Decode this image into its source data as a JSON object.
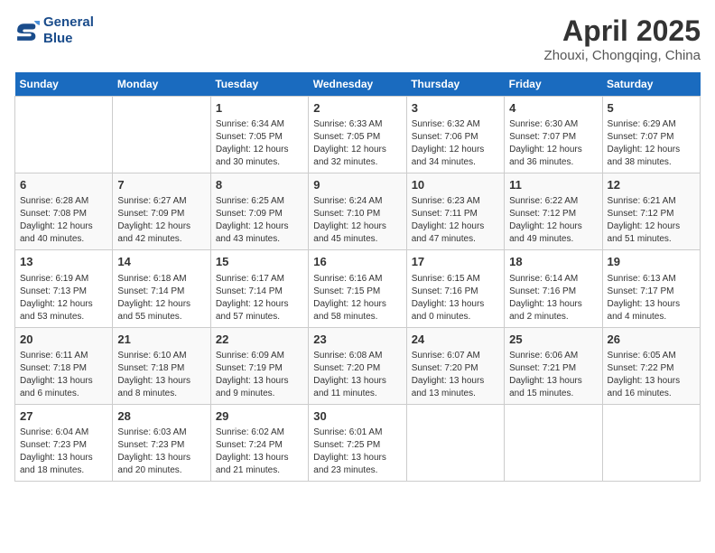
{
  "header": {
    "logo_line1": "General",
    "logo_line2": "Blue",
    "month": "April 2025",
    "location": "Zhouxi, Chongqing, China"
  },
  "weekdays": [
    "Sunday",
    "Monday",
    "Tuesday",
    "Wednesday",
    "Thursday",
    "Friday",
    "Saturday"
  ],
  "weeks": [
    [
      {
        "day": null
      },
      {
        "day": null
      },
      {
        "day": 1,
        "sunrise": "6:34 AM",
        "sunset": "7:05 PM",
        "daylight": "12 hours and 30 minutes."
      },
      {
        "day": 2,
        "sunrise": "6:33 AM",
        "sunset": "7:05 PM",
        "daylight": "12 hours and 32 minutes."
      },
      {
        "day": 3,
        "sunrise": "6:32 AM",
        "sunset": "7:06 PM",
        "daylight": "12 hours and 34 minutes."
      },
      {
        "day": 4,
        "sunrise": "6:30 AM",
        "sunset": "7:07 PM",
        "daylight": "12 hours and 36 minutes."
      },
      {
        "day": 5,
        "sunrise": "6:29 AM",
        "sunset": "7:07 PM",
        "daylight": "12 hours and 38 minutes."
      }
    ],
    [
      {
        "day": 6,
        "sunrise": "6:28 AM",
        "sunset": "7:08 PM",
        "daylight": "12 hours and 40 minutes."
      },
      {
        "day": 7,
        "sunrise": "6:27 AM",
        "sunset": "7:09 PM",
        "daylight": "12 hours and 42 minutes."
      },
      {
        "day": 8,
        "sunrise": "6:25 AM",
        "sunset": "7:09 PM",
        "daylight": "12 hours and 43 minutes."
      },
      {
        "day": 9,
        "sunrise": "6:24 AM",
        "sunset": "7:10 PM",
        "daylight": "12 hours and 45 minutes."
      },
      {
        "day": 10,
        "sunrise": "6:23 AM",
        "sunset": "7:11 PM",
        "daylight": "12 hours and 47 minutes."
      },
      {
        "day": 11,
        "sunrise": "6:22 AM",
        "sunset": "7:12 PM",
        "daylight": "12 hours and 49 minutes."
      },
      {
        "day": 12,
        "sunrise": "6:21 AM",
        "sunset": "7:12 PM",
        "daylight": "12 hours and 51 minutes."
      }
    ],
    [
      {
        "day": 13,
        "sunrise": "6:19 AM",
        "sunset": "7:13 PM",
        "daylight": "12 hours and 53 minutes."
      },
      {
        "day": 14,
        "sunrise": "6:18 AM",
        "sunset": "7:14 PM",
        "daylight": "12 hours and 55 minutes."
      },
      {
        "day": 15,
        "sunrise": "6:17 AM",
        "sunset": "7:14 PM",
        "daylight": "12 hours and 57 minutes."
      },
      {
        "day": 16,
        "sunrise": "6:16 AM",
        "sunset": "7:15 PM",
        "daylight": "12 hours and 58 minutes."
      },
      {
        "day": 17,
        "sunrise": "6:15 AM",
        "sunset": "7:16 PM",
        "daylight": "13 hours and 0 minutes."
      },
      {
        "day": 18,
        "sunrise": "6:14 AM",
        "sunset": "7:16 PM",
        "daylight": "13 hours and 2 minutes."
      },
      {
        "day": 19,
        "sunrise": "6:13 AM",
        "sunset": "7:17 PM",
        "daylight": "13 hours and 4 minutes."
      }
    ],
    [
      {
        "day": 20,
        "sunrise": "6:11 AM",
        "sunset": "7:18 PM",
        "daylight": "13 hours and 6 minutes."
      },
      {
        "day": 21,
        "sunrise": "6:10 AM",
        "sunset": "7:18 PM",
        "daylight": "13 hours and 8 minutes."
      },
      {
        "day": 22,
        "sunrise": "6:09 AM",
        "sunset": "7:19 PM",
        "daylight": "13 hours and 9 minutes."
      },
      {
        "day": 23,
        "sunrise": "6:08 AM",
        "sunset": "7:20 PM",
        "daylight": "13 hours and 11 minutes."
      },
      {
        "day": 24,
        "sunrise": "6:07 AM",
        "sunset": "7:20 PM",
        "daylight": "13 hours and 13 minutes."
      },
      {
        "day": 25,
        "sunrise": "6:06 AM",
        "sunset": "7:21 PM",
        "daylight": "13 hours and 15 minutes."
      },
      {
        "day": 26,
        "sunrise": "6:05 AM",
        "sunset": "7:22 PM",
        "daylight": "13 hours and 16 minutes."
      }
    ],
    [
      {
        "day": 27,
        "sunrise": "6:04 AM",
        "sunset": "7:23 PM",
        "daylight": "13 hours and 18 minutes."
      },
      {
        "day": 28,
        "sunrise": "6:03 AM",
        "sunset": "7:23 PM",
        "daylight": "13 hours and 20 minutes."
      },
      {
        "day": 29,
        "sunrise": "6:02 AM",
        "sunset": "7:24 PM",
        "daylight": "13 hours and 21 minutes."
      },
      {
        "day": 30,
        "sunrise": "6:01 AM",
        "sunset": "7:25 PM",
        "daylight": "13 hours and 23 minutes."
      },
      {
        "day": null
      },
      {
        "day": null
      },
      {
        "day": null
      }
    ]
  ]
}
